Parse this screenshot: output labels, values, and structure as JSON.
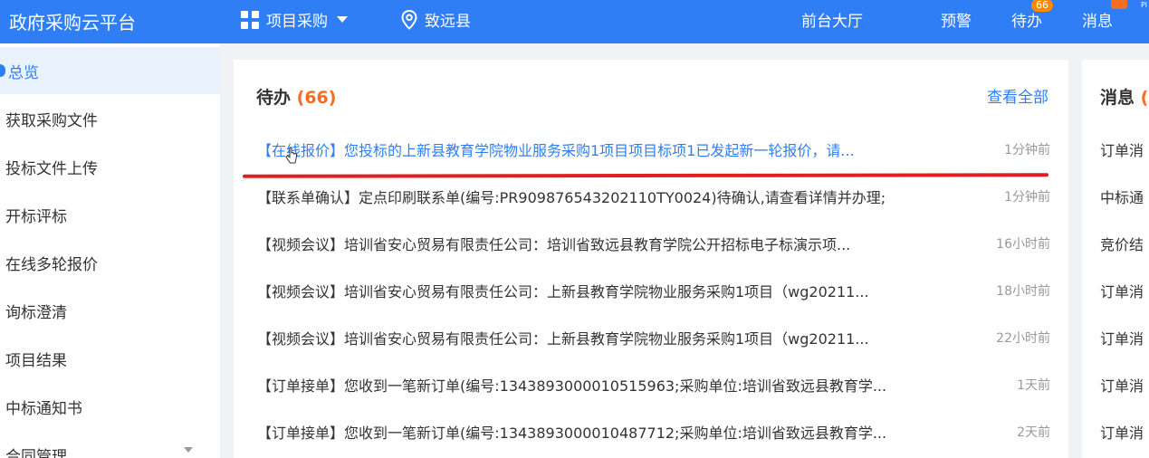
{
  "header": {
    "brand": "政府采购云平台",
    "project_menu": "项目采购",
    "location": "致远县",
    "front_hall": "前台大厅",
    "alert": "预警",
    "todo": "待办",
    "todo_badge": "66",
    "messages": "消息",
    "corner_text": "Pl"
  },
  "sidebar": {
    "items": [
      {
        "label": "总览"
      },
      {
        "label": "获取采购文件"
      },
      {
        "label": "投标文件上传"
      },
      {
        "label": "开标评标"
      },
      {
        "label": "在线多轮报价"
      },
      {
        "label": "询标澄清"
      },
      {
        "label": "项目结果"
      },
      {
        "label": "中标通知书"
      },
      {
        "label": "合同管理"
      }
    ]
  },
  "todo_panel": {
    "title": "待办",
    "count": "(66)",
    "view_all": "查看全部",
    "items": [
      {
        "text": "【在线报价】您投标的上新县教育学院物业服务采购1项目项目标项1已发起新一轮报价，请...",
        "time": "1分钟前"
      },
      {
        "text": "【联系单确认】定点印刷联系单(编号:PR909876543202110TY0024)待确认,请查看详情并办理;",
        "time": "1分钟前"
      },
      {
        "text": "【视频会议】培训省安心贸易有限责任公司：培训省致远县教育学院公开招标电子标演示项...",
        "time": "16小时前"
      },
      {
        "text": "【视频会议】培训省安心贸易有限责任公司：上新县教育学院物业服务采购1项目（wg20211...",
        "time": "18小时前"
      },
      {
        "text": "【视频会议】培训省安心贸易有限责任公司：上新县教育学院物业服务采购1项目（wg20211...",
        "time": "22小时前"
      },
      {
        "text": "【订单接单】您收到一笔新订单(编号:134389300001051596​3;采购单位:培训省致远县教育学...",
        "time": "1天前"
      },
      {
        "text": "【订单接单】您收到一笔新订单(编号:134389300001048771​2;采购单位:培训省致远县教育学...",
        "time": "2天前"
      }
    ]
  },
  "message_panel": {
    "title": "消息",
    "count": "(",
    "items": [
      {
        "text": "订单消"
      },
      {
        "text": "中标通"
      },
      {
        "text": "竞价结"
      },
      {
        "text": "订单消"
      },
      {
        "text": "订单消"
      },
      {
        "text": "订单消"
      },
      {
        "text": "订单消"
      }
    ]
  },
  "colors": {
    "primary": "#2f7ef5",
    "accent": "#f56c22",
    "annotation": "#e02020"
  }
}
